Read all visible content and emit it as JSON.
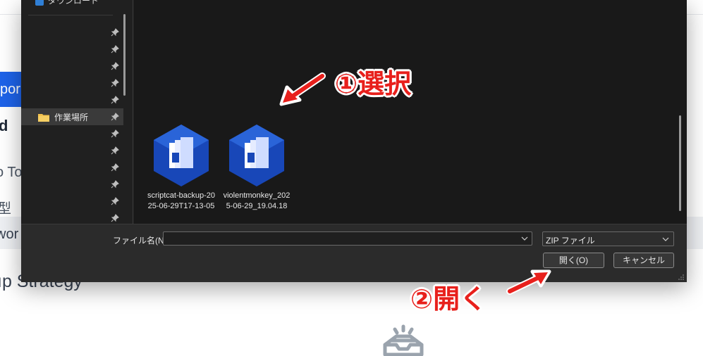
{
  "background_page": {
    "tab_label": "por",
    "heading": "d",
    "text_line_1": "o To",
    "text_line_2": "型",
    "row_text": "wor",
    "section_heading": "ıp Strategy"
  },
  "dialog": {
    "sidebar": {
      "top_item_label": "ダウンロード",
      "selected_folder_label": "作業場所"
    },
    "files": [
      {
        "name": "scriptcat-backup-2025-06-29T17-13-05",
        "icon": "zip-archive-icon"
      },
      {
        "name": "violentmonkey_2025-06-29_19.04.18",
        "icon": "zip-archive-icon"
      }
    ],
    "filename_label": "ファイル名(N):",
    "filename_value": "",
    "filetype_value": "ZIP ファイル",
    "open_button": "開く(O)",
    "cancel_button": "キャンセル"
  },
  "annotations": {
    "step1": "①選択",
    "step2": "②開く",
    "color": "#e8201c"
  },
  "colors": {
    "dialog_bg": "#202020",
    "content_bg": "#191919",
    "accent_blue": "#1e63e9",
    "folder_yellow": "#f2c14e"
  }
}
